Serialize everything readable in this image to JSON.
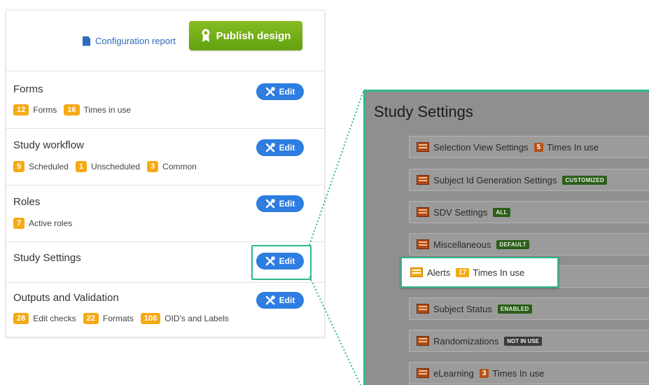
{
  "toolbar": {
    "config_report": "Configuration report",
    "publish": "Publish design"
  },
  "edit_label": "Edit",
  "sections": [
    {
      "title": "Forms",
      "stats": [
        {
          "count": "12",
          "label": "Forms"
        },
        {
          "count": "16",
          "label": "Times in use"
        }
      ]
    },
    {
      "title": "Study workflow",
      "stats": [
        {
          "count": "5",
          "label": "Scheduled"
        },
        {
          "count": "1",
          "label": "Unscheduled"
        },
        {
          "count": "3",
          "label": "Common"
        }
      ]
    },
    {
      "title": "Roles",
      "stats": [
        {
          "count": "7",
          "label": "Active roles"
        }
      ]
    },
    {
      "title": "Study Settings",
      "stats": []
    },
    {
      "title": "Outputs and Validation",
      "stats": [
        {
          "count": "28",
          "label": "Edit checks"
        },
        {
          "count": "22",
          "label": "Formats"
        },
        {
          "count": "106",
          "label": "OID's and Labels"
        }
      ]
    }
  ],
  "zoom": {
    "title": "Study Settings",
    "rows": [
      {
        "name": "Selection View Settings",
        "count": "5",
        "suffix": "Times In use",
        "tag": ""
      },
      {
        "name": "Subject Id Generation Settings",
        "count": "",
        "suffix": "",
        "tag": "CUSTOMIZED",
        "tag_style": "green"
      },
      {
        "name": "SDV Settings",
        "count": "",
        "suffix": "",
        "tag": "ALL",
        "tag_style": "green"
      },
      {
        "name": "Miscellaneous",
        "count": "",
        "suffix": "",
        "tag": "DEFAULT",
        "tag_style": "green"
      },
      {
        "name": "Alerts",
        "count": "17",
        "suffix": "Times In use",
        "tag": "",
        "highlighted": true
      },
      {
        "name": "Subject Status",
        "count": "",
        "suffix": "",
        "tag": "ENABLED",
        "tag_style": "green"
      },
      {
        "name": "Randomizations",
        "count": "",
        "suffix": "",
        "tag": "NOT IN USE",
        "tag_style": "black"
      },
      {
        "name": "eLearning",
        "count": "3",
        "suffix": "Times In use",
        "tag": ""
      }
    ]
  },
  "colors": {
    "accent_blue": "#2e7de0",
    "publish_green": "#6fae15",
    "count_orange": "#f5a914",
    "highlight_teal": "#2fb68e"
  }
}
